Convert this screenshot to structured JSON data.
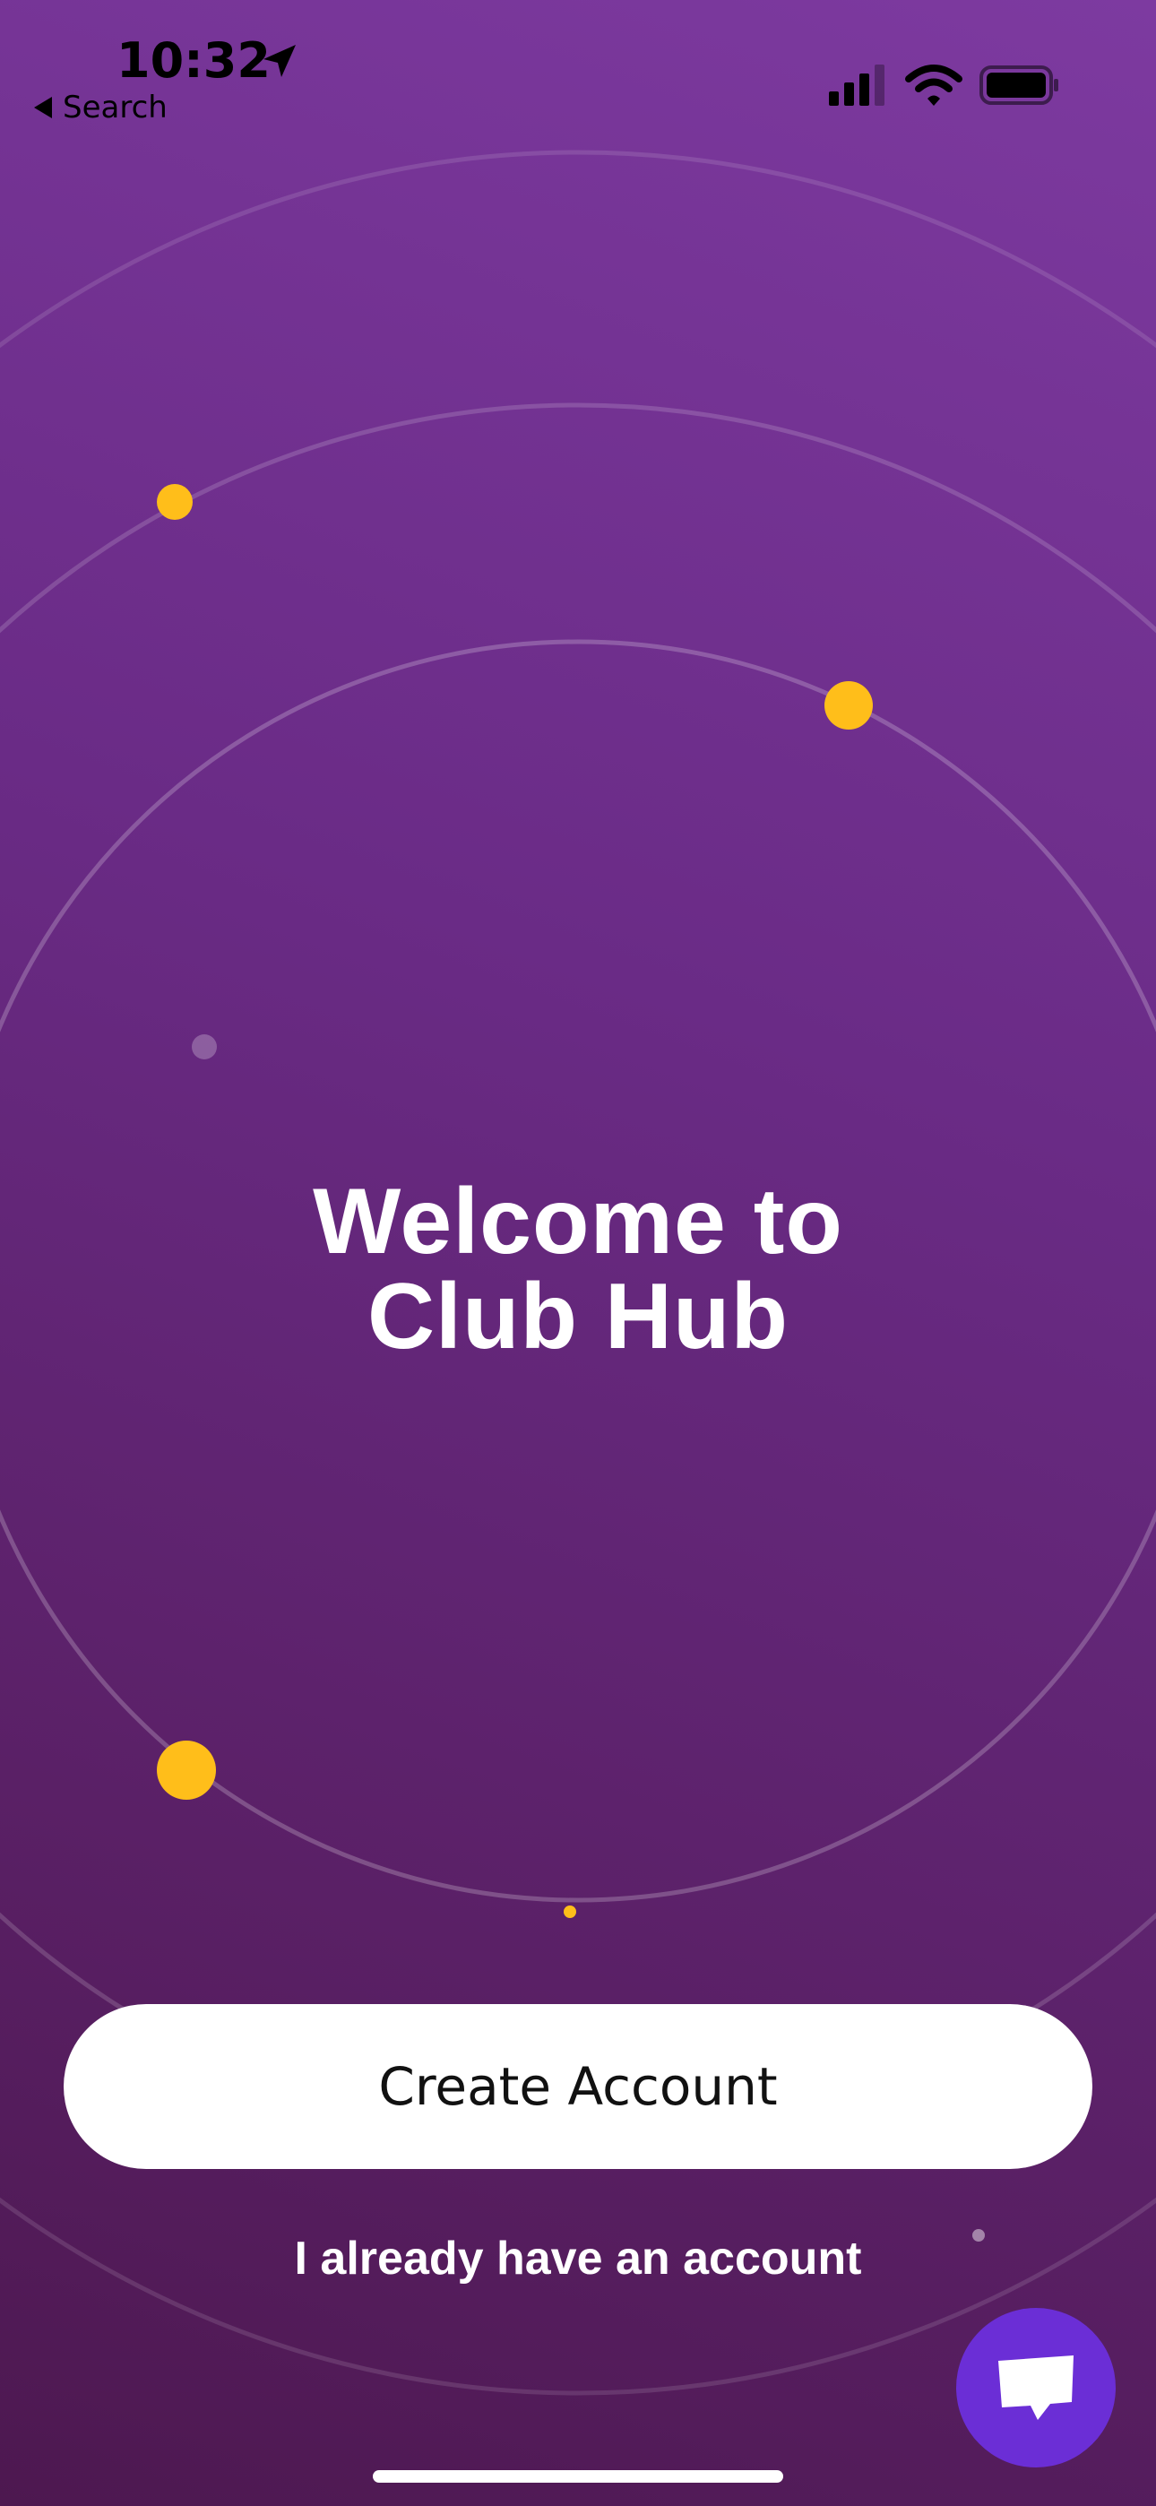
{
  "status_bar": {
    "time": "10:32",
    "back_label": "Search",
    "icons": [
      "location-arrow-icon",
      "cellular-signal-icon",
      "wifi-icon",
      "battery-icon"
    ]
  },
  "welcome": {
    "title_line1": "Welcome to",
    "title_line2": "Club Hub"
  },
  "actions": {
    "create_account_label": "Create Account",
    "login_label": "I already have an account"
  },
  "support": {
    "icon": "chat-bubble-icon"
  },
  "colors": {
    "background_top": "#7d3aa0",
    "background_bottom": "#4d1850",
    "accent_dot": "#ffbe1a",
    "chat_button": "#6b2ed6"
  }
}
